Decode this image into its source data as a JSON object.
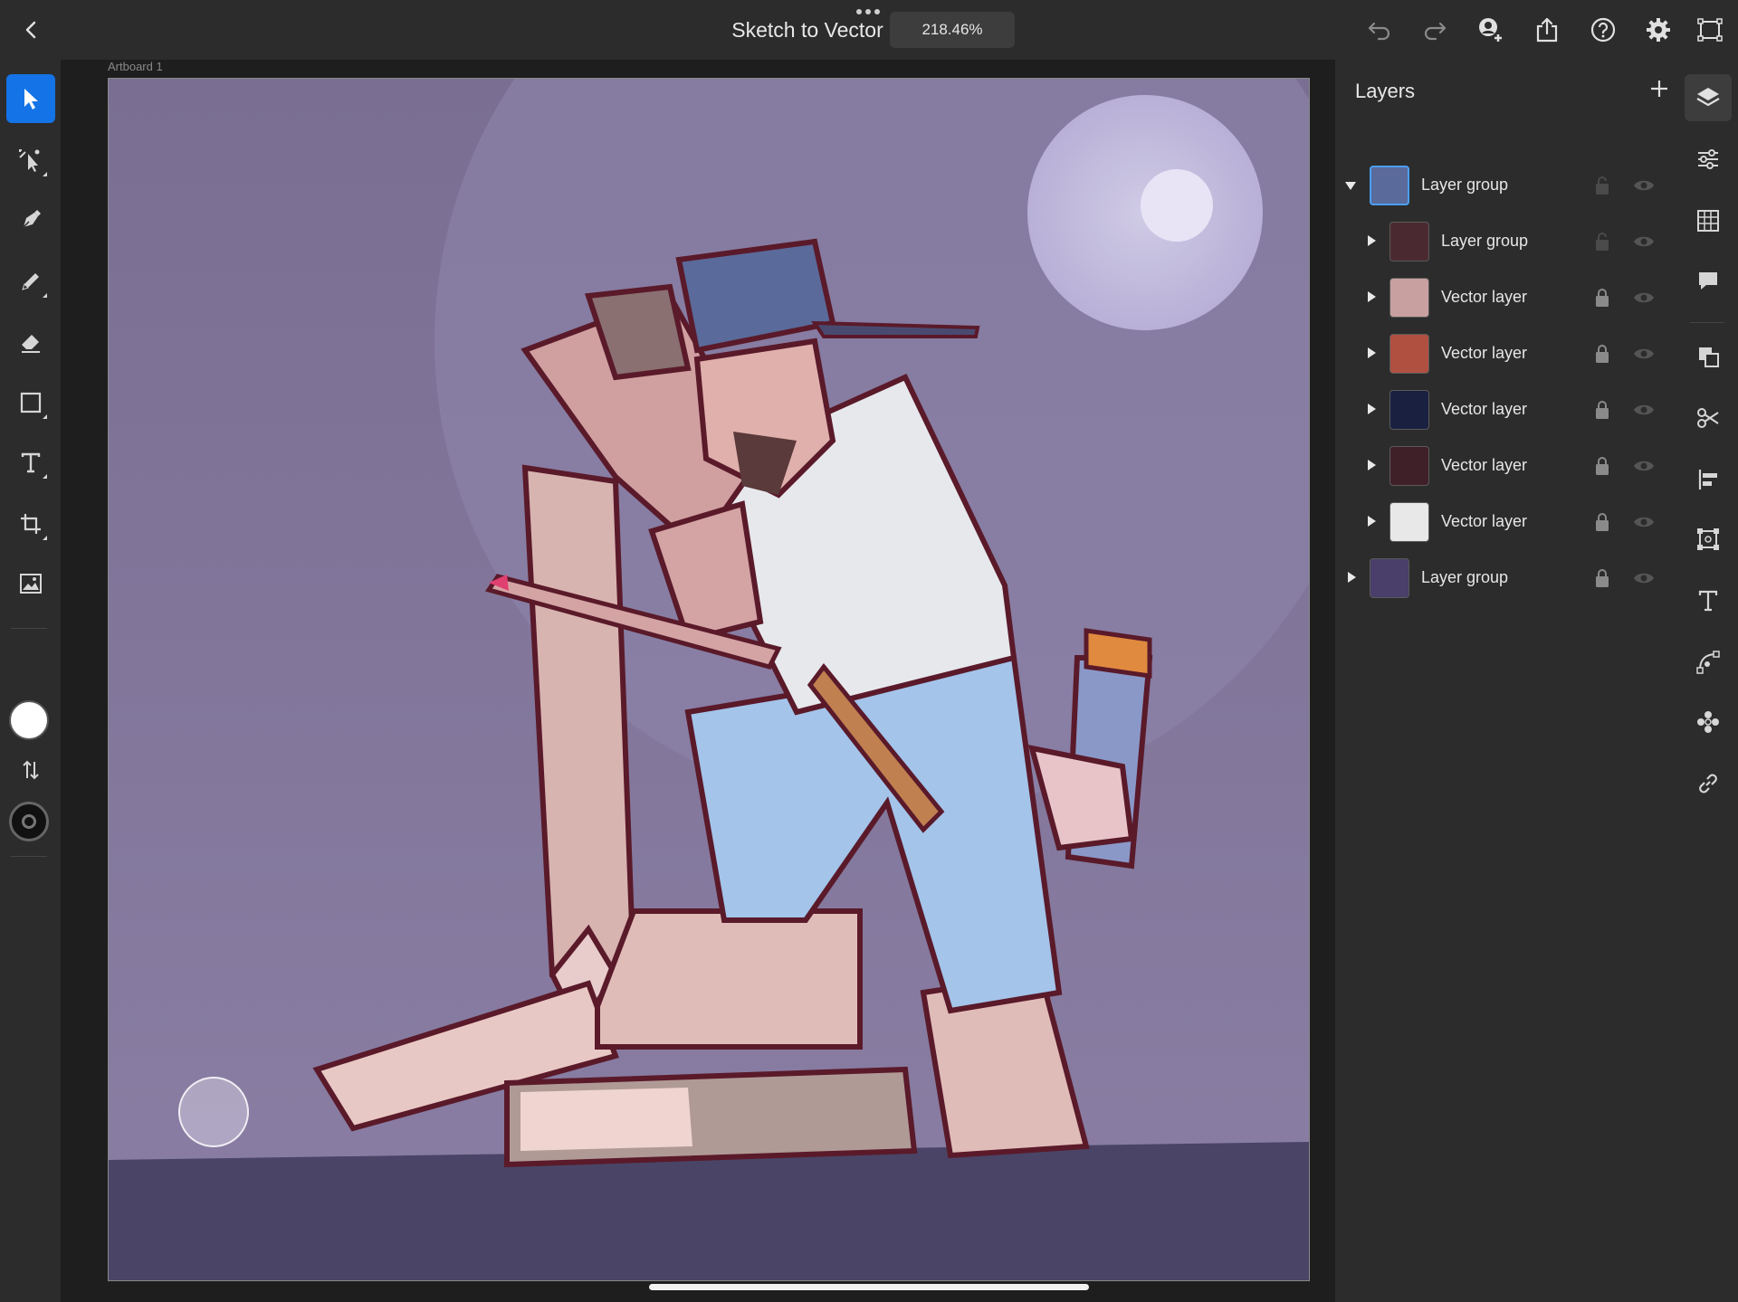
{
  "topbar": {
    "document_title": "Sketch to Vector",
    "zoom_level": "218.46%",
    "icons": [
      "back-icon",
      "more-dots-icon",
      "undo-icon",
      "redo-icon",
      "invite-user-icon",
      "share-icon",
      "help-icon",
      "settings-icon",
      "canvas-fit-icon"
    ]
  },
  "left_toolbar": {
    "tools": [
      "selection-tool",
      "direct-selection-tool",
      "pen-tool",
      "pencil-tool",
      "eraser-tool",
      "shape-tool",
      "text-tool",
      "crop-tool",
      "place-image-tool"
    ],
    "active_tool": "selection-tool",
    "fill_color": "#ffffff",
    "stroke_color": "#111111"
  },
  "canvas": {
    "artboard_label": "Artboard 1",
    "background_color": "#807597",
    "ground_color": "#4a4566"
  },
  "layers_panel": {
    "title": "Layers",
    "add_label": "+",
    "layers": [
      {
        "name": "Layer group",
        "indent": 0,
        "expanded": true,
        "locked": false,
        "selected": true,
        "thumb": "#5a6a9a"
      },
      {
        "name": "Layer group",
        "indent": 1,
        "expanded": false,
        "locked": false,
        "selected": false,
        "thumb": "#4a2a30"
      },
      {
        "name": "Vector layer",
        "indent": 1,
        "expanded": false,
        "locked": true,
        "selected": false,
        "thumb": "#c8a0a0"
      },
      {
        "name": "Vector layer",
        "indent": 1,
        "expanded": false,
        "locked": true,
        "selected": false,
        "thumb": "#b05040"
      },
      {
        "name": "Vector layer",
        "indent": 1,
        "expanded": false,
        "locked": true,
        "selected": false,
        "thumb": "#1a2040"
      },
      {
        "name": "Vector layer",
        "indent": 1,
        "expanded": false,
        "locked": true,
        "selected": false,
        "thumb": "#402028"
      },
      {
        "name": "Vector layer",
        "indent": 1,
        "expanded": false,
        "locked": true,
        "selected": false,
        "thumb": "#e8e8e8"
      },
      {
        "name": "Layer group",
        "indent": 0,
        "expanded": false,
        "locked": true,
        "selected": false,
        "thumb": "#4a3e6a"
      }
    ]
  },
  "right_toolbar": {
    "tools": [
      "layers-icon",
      "properties-icon",
      "grid-icon",
      "comment-icon",
      "arrange-icon",
      "cut-icon",
      "align-icon",
      "transform-icon",
      "type-icon",
      "path-icon",
      "repeat-icon",
      "link-icon"
    ],
    "active": "layers-icon"
  },
  "colors": {
    "accent": "#1473e6",
    "panel_bg": "#2c2c2c",
    "canvas_bg": "#1e1e1e"
  }
}
